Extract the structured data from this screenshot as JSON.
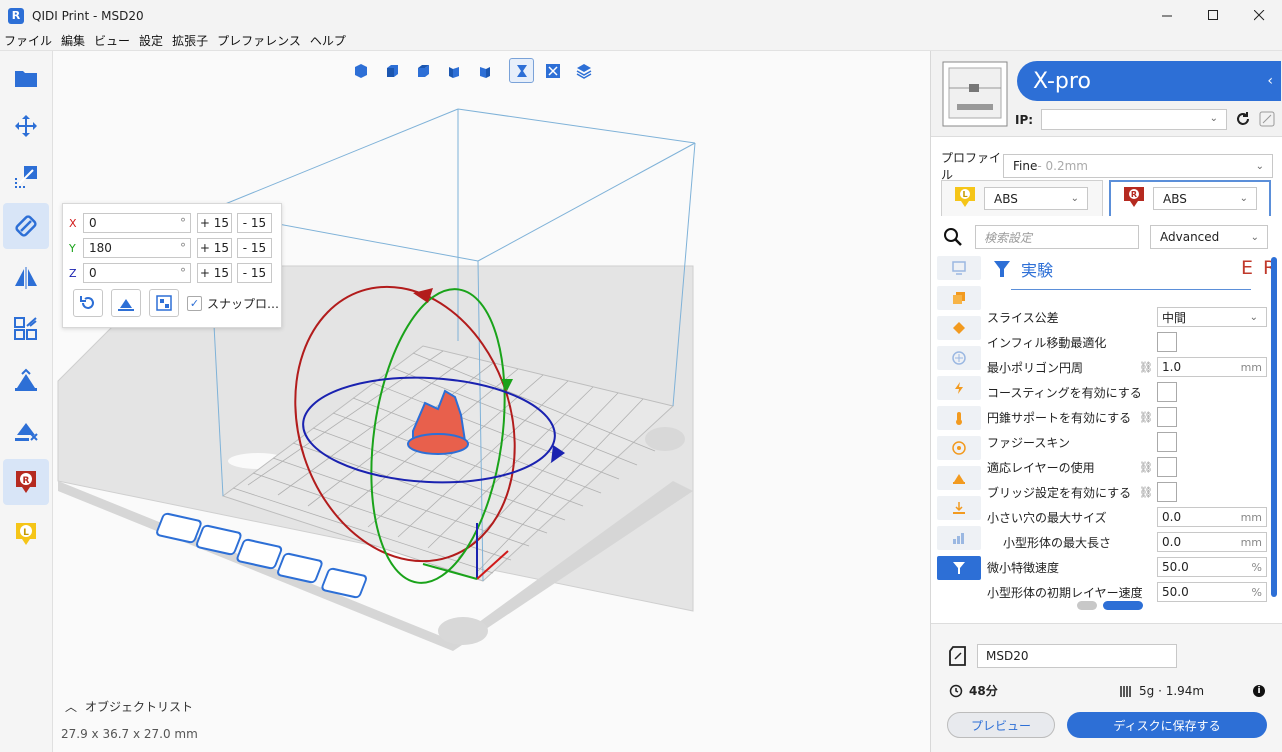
{
  "window": {
    "title": "QIDI Print - MSD20",
    "logo": "R"
  },
  "menu": [
    "ファイル",
    "編集",
    "ビュー",
    "設定",
    "拡張子",
    "プレファレンス",
    "ヘルプ"
  ],
  "rotate_panel": {
    "x_label": "X",
    "y_label": "Y",
    "z_label": "Z",
    "x_value": "0",
    "y_value": "180",
    "z_value": "0",
    "deg": "°",
    "plus": "+ 15",
    "minus": "- 15",
    "snap_label": "スナップロ…"
  },
  "viewport": {
    "object_list_label": "オブジェクトリスト",
    "dimensions": "27.9 x 36.7 x 27.0 mm"
  },
  "printer": {
    "name": "X-pro",
    "ip_label": "IP:",
    "ip_value": ""
  },
  "profile": {
    "label": "プロファイル",
    "value": "Fine",
    "detail": " - 0.2mm"
  },
  "extruders": [
    {
      "badge": "L",
      "material": "ABS"
    },
    {
      "badge": "R",
      "material": "ABS"
    }
  ],
  "settings_search": {
    "placeholder": "検索設定",
    "mode": "Advanced"
  },
  "section": {
    "title": "実験",
    "right_tag": "E R"
  },
  "settings": [
    {
      "label": "スライス公差",
      "type": "select",
      "value": "中間",
      "linked": false
    },
    {
      "label": "インフィル移動最適化",
      "type": "check",
      "linked": false
    },
    {
      "label": "最小ポリゴン円周",
      "type": "num",
      "value": "1.0",
      "unit": "mm",
      "linked": true
    },
    {
      "label": "コースティングを有効にする",
      "type": "check",
      "linked": false
    },
    {
      "label": "円錐サポートを有効にする",
      "type": "check",
      "linked": true
    },
    {
      "label": "ファジースキン",
      "type": "check",
      "linked": false
    },
    {
      "label": "適応レイヤーの使用",
      "type": "check",
      "linked": true
    },
    {
      "label": "ブリッジ設定を有効にする",
      "type": "check",
      "linked": true
    },
    {
      "label": "小さい穴の最大サイズ",
      "type": "num",
      "value": "0.0",
      "unit": "mm",
      "linked": false
    },
    {
      "label": "小型形体の最大長さ",
      "type": "num",
      "value": "0.0",
      "unit": "mm",
      "linked": false
    },
    {
      "label": "微小特徴速度",
      "type": "num",
      "value": "50.0",
      "unit": "%",
      "linked": false
    },
    {
      "label": "小型形体の初期レイヤー速度",
      "type": "num",
      "value": "50.0",
      "unit": "%",
      "linked": false
    }
  ],
  "output": {
    "filename": "MSD20",
    "time": "48分",
    "material": "5g · 1.94m",
    "preview_label": "プレビュー",
    "save_label": "ディスクに保存する"
  },
  "colors": {
    "accent": "#2d6fd6",
    "model": "#e8604c",
    "x_axis": "#d11a1a",
    "y_axis": "#1aa31a",
    "z_axis": "#1a22b0"
  }
}
